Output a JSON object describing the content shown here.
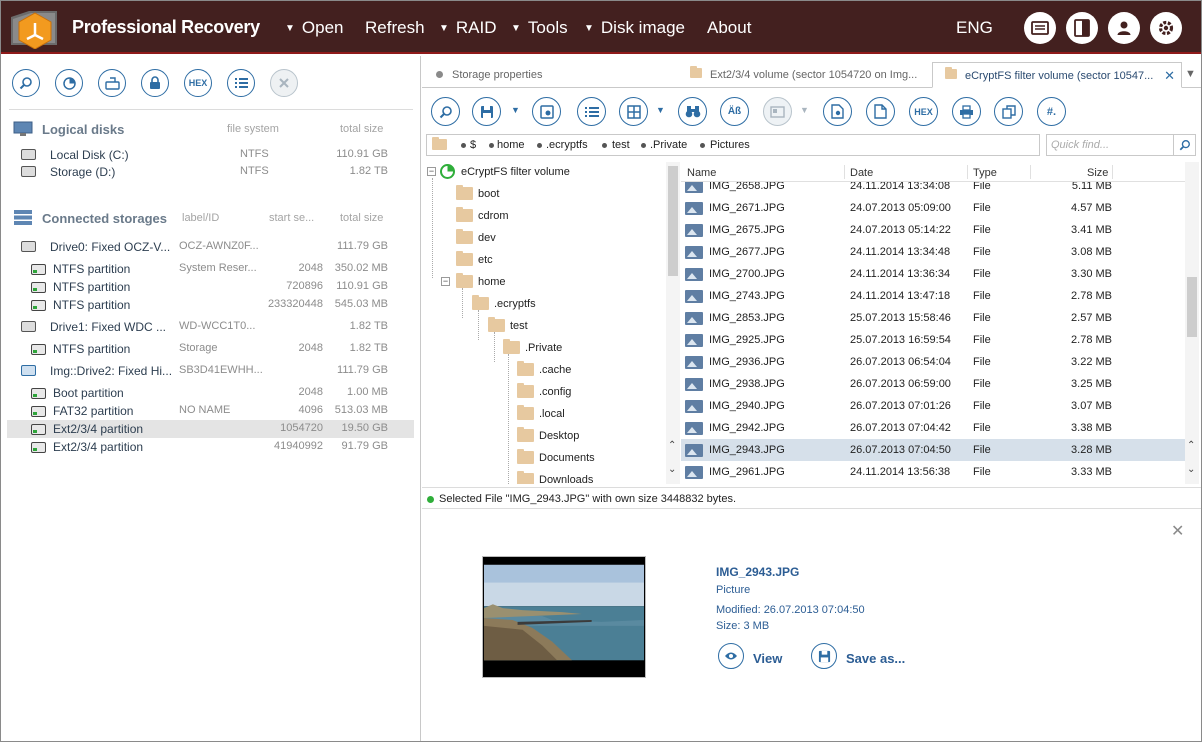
{
  "app": {
    "title": "Professional Recovery",
    "lang": "ENG"
  },
  "menu": [
    {
      "label": "Open",
      "arrow": true
    },
    {
      "label": "Refresh",
      "arrow": false
    },
    {
      "label": "RAID",
      "arrow": true
    },
    {
      "label": "Tools",
      "arrow": true
    },
    {
      "label": "Disk image",
      "arrow": true
    },
    {
      "label": "About",
      "arrow": false
    }
  ],
  "top_icons": [
    "report-icon",
    "panel-toggle-icon",
    "user-icon",
    "gear-icon"
  ],
  "left_toolbar": {
    "hex_label": "HEX",
    "buttons": [
      "search-icon",
      "disk-chart-icon",
      "disk-image-icon",
      "lock-icon",
      "hex-icon",
      "list-icon",
      "close-icon"
    ]
  },
  "logical_disks": {
    "title": "Logical disks",
    "col_fs": "file system",
    "col_size": "total size",
    "items": [
      {
        "name": "Local Disk (C:)",
        "fs": "NTFS",
        "size": "110.91 GB"
      },
      {
        "name": "Storage (D:)",
        "fs": "NTFS",
        "size": "1.82 TB"
      }
    ]
  },
  "connected_storages": {
    "title": "Connected storages",
    "col_label": "label/ID",
    "col_start": "start se...",
    "col_size": "total size",
    "items": [
      {
        "name": "Drive0: Fixed OCZ-V...",
        "label": "OCZ-AWNZ0F...",
        "start": "",
        "size": "111.79 GB",
        "kind": "drive",
        "level": 0
      },
      {
        "name": "NTFS partition",
        "label": "System Reser...",
        "start": "2048",
        "size": "350.02 MB",
        "kind": "part",
        "level": 1
      },
      {
        "name": "NTFS partition",
        "label": "",
        "start": "720896",
        "size": "110.91 GB",
        "kind": "part",
        "level": 1
      },
      {
        "name": "NTFS partition",
        "label": "",
        "start": "233320448",
        "size": "545.03 MB",
        "kind": "part",
        "level": 1
      },
      {
        "name": "Drive1: Fixed WDC ...",
        "label": "WD-WCC1T0...",
        "start": "",
        "size": "1.82 TB",
        "kind": "drive",
        "level": 0
      },
      {
        "name": "NTFS partition",
        "label": "Storage",
        "start": "2048",
        "size": "1.82 TB",
        "kind": "part",
        "level": 1
      },
      {
        "name": "Img::Drive2: Fixed Hi...",
        "label": "SB3D41EWHH...",
        "start": "",
        "size": "111.79 GB",
        "kind": "img",
        "level": 0
      },
      {
        "name": "Boot partition",
        "label": "",
        "start": "2048",
        "size": "1.00 MB",
        "kind": "part",
        "level": 1
      },
      {
        "name": "FAT32 partition",
        "label": "NO NAME",
        "start": "4096",
        "size": "513.03 MB",
        "kind": "part",
        "level": 1
      },
      {
        "name": "Ext2/3/4 partition",
        "label": "",
        "start": "1054720",
        "size": "19.50 GB",
        "kind": "part",
        "level": 1,
        "selected": true
      },
      {
        "name": "Ext2/3/4 partition",
        "label": "",
        "start": "41940992",
        "size": "91.79 GB",
        "kind": "part",
        "level": 1
      }
    ]
  },
  "tabs": [
    {
      "label": "Storage properties",
      "active": false
    },
    {
      "label": "Ext2/3/4 volume (sector 1054720 on Img...",
      "active": false
    },
    {
      "label": "eCryptFS filter volume (sector 10547...",
      "active": true
    }
  ],
  "right_toolbar": {
    "hex_label": "HEX",
    "hash_label": "#.",
    "text_label": "Äß"
  },
  "path": [
    "$",
    "home",
    ".ecryptfs",
    "test",
    ".Private",
    "Pictures"
  ],
  "quick_find": {
    "placeholder": "Quick find..."
  },
  "tree": [
    {
      "label": "eCryptFS filter volume",
      "depth": 0,
      "exp": "−",
      "root": true
    },
    {
      "label": "boot",
      "depth": 1,
      "exp": ""
    },
    {
      "label": "cdrom",
      "depth": 1,
      "exp": ""
    },
    {
      "label": "dev",
      "depth": 1,
      "exp": ""
    },
    {
      "label": "etc",
      "depth": 1,
      "exp": ""
    },
    {
      "label": "home",
      "depth": 1,
      "exp": "−"
    },
    {
      "label": ".ecryptfs",
      "depth": 2,
      "exp": "−"
    },
    {
      "label": "test",
      "depth": 3,
      "exp": "−"
    },
    {
      "label": ".Private",
      "depth": 4,
      "exp": "−"
    },
    {
      "label": ".cache",
      "depth": 5,
      "exp": ""
    },
    {
      "label": ".config",
      "depth": 5,
      "exp": ""
    },
    {
      "label": ".local",
      "depth": 5,
      "exp": ""
    },
    {
      "label": "Desktop",
      "depth": 5,
      "exp": ""
    },
    {
      "label": "Documents",
      "depth": 5,
      "exp": ""
    },
    {
      "label": "Downloads",
      "depth": 5,
      "exp": ""
    }
  ],
  "file_columns": {
    "name": "Name",
    "date": "Date",
    "type": "Type",
    "size": "Size"
  },
  "files": [
    {
      "name": "IMG_2658.JPG",
      "date": "24.11.2014 13:34:08",
      "type": "File",
      "size": "5.11 MB"
    },
    {
      "name": "IMG_2671.JPG",
      "date": "24.07.2013 05:09:00",
      "type": "File",
      "size": "4.57 MB"
    },
    {
      "name": "IMG_2675.JPG",
      "date": "24.07.2013 05:14:22",
      "type": "File",
      "size": "3.41 MB"
    },
    {
      "name": "IMG_2677.JPG",
      "date": "24.11.2014 13:34:48",
      "type": "File",
      "size": "3.08 MB"
    },
    {
      "name": "IMG_2700.JPG",
      "date": "24.11.2014 13:36:34",
      "type": "File",
      "size": "3.30 MB"
    },
    {
      "name": "IMG_2743.JPG",
      "date": "24.11.2014 13:47:18",
      "type": "File",
      "size": "2.78 MB"
    },
    {
      "name": "IMG_2853.JPG",
      "date": "25.07.2013 15:58:46",
      "type": "File",
      "size": "2.57 MB"
    },
    {
      "name": "IMG_2925.JPG",
      "date": "25.07.2013 16:59:54",
      "type": "File",
      "size": "2.78 MB"
    },
    {
      "name": "IMG_2936.JPG",
      "date": "26.07.2013 06:54:04",
      "type": "File",
      "size": "3.22 MB"
    },
    {
      "name": "IMG_2938.JPG",
      "date": "26.07.2013 06:59:00",
      "type": "File",
      "size": "3.25 MB"
    },
    {
      "name": "IMG_2940.JPG",
      "date": "26.07.2013 07:01:26",
      "type": "File",
      "size": "3.07 MB"
    },
    {
      "name": "IMG_2942.JPG",
      "date": "26.07.2013 07:04:42",
      "type": "File",
      "size": "3.38 MB"
    },
    {
      "name": "IMG_2943.JPG",
      "date": "26.07.2013 07:04:50",
      "type": "File",
      "size": "3.28 MB",
      "selected": true
    },
    {
      "name": "IMG_2961.JPG",
      "date": "24.11.2014 13:56:38",
      "type": "File",
      "size": "3.33 MB"
    }
  ],
  "status": {
    "text": "Selected File \"IMG_2943.JPG\" with own size 3448832 bytes."
  },
  "preview": {
    "name": "IMG_2943.JPG",
    "kind": "Picture",
    "modified": "Modified: 26.07.2013 07:04:50",
    "size": "Size: 3 MB",
    "view_label": "View",
    "save_label": "Save as..."
  },
  "colors": {
    "topbar": "#43201f",
    "accent": "#2e6da4",
    "selected_row": "#d6e0ea"
  }
}
